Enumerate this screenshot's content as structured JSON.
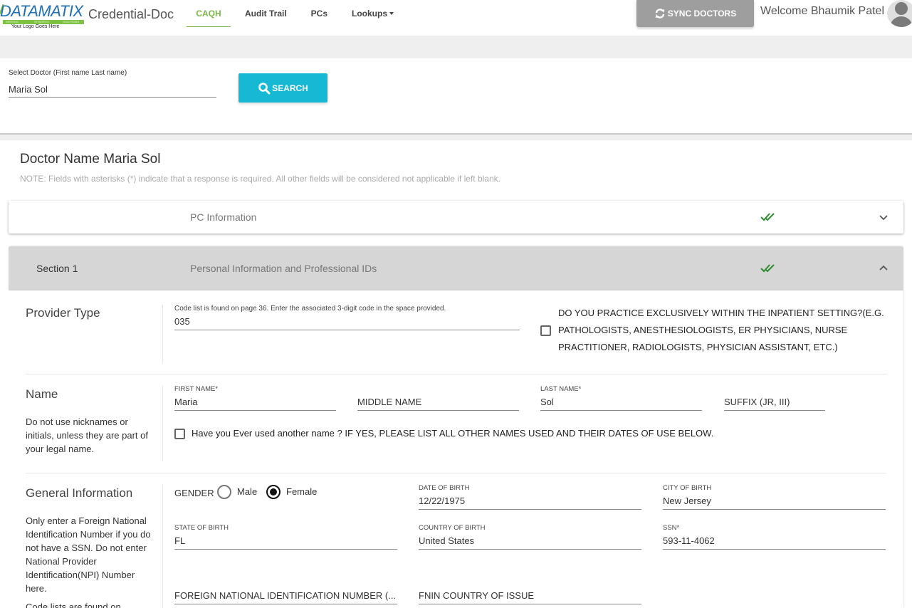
{
  "header": {
    "logo_word": "DATAMATIX",
    "logo_tags": [
      "SERVING",
      "STRATEGY",
      "SOLUTIONS"
    ],
    "logo_subtitle": "Your Logo Goes Here",
    "app_name": "Credential-Doc",
    "nav": [
      {
        "label": "CAQH",
        "active": true
      },
      {
        "label": "Audit Trail",
        "active": false
      },
      {
        "label": "PCs",
        "active": false
      },
      {
        "label": "Lookups",
        "active": false,
        "dropdown": true
      }
    ],
    "sync_label": "SYNC DOCTORS",
    "welcome": "Welcome Bhaumik Patel"
  },
  "search": {
    "label": "Select Doctor (First name Last name)",
    "value": "Maria Sol",
    "button_label": "SEARCH"
  },
  "main": {
    "title": "Doctor Name Maria Sol",
    "note": "NOTE: Fields with asterisks (*) indicate that a response is required. All other fields will be considered not applicable if left blank.",
    "accordions": [
      {
        "section": "",
        "title": "PC Information",
        "complete": true,
        "expanded": false
      },
      {
        "section": "Section 1",
        "title": "Personal Information and Professional IDs",
        "complete": true,
        "expanded": true
      }
    ]
  },
  "section1": {
    "provider_type": {
      "heading": "Provider Type",
      "code_label": "Code list is found on page 36. Enter the associated 3-digit code in the space provided.",
      "code_value": "035",
      "inpatient_question": "DO YOU PRACTICE EXCLUSIVELY WITHIN THE INPATIENT SETTING?(E.G. PATHOLOGISTS, ANESTHESIOLOGISTS, ER PHYSICIANS, NURSE PRACTITIONER, RADIOLOGISTS, PHYSICIAN ASSISTANT, ETC.)",
      "inpatient_checked": false
    },
    "name": {
      "heading": "Name",
      "description": "Do not use nicknames or initials, unless they are part of your legal name.",
      "first_name_label": "FIRST NAME*",
      "first_name": "Maria",
      "middle_name_placeholder": "MIDDLE NAME",
      "middle_name": "",
      "last_name_label": "LAST NAME*",
      "last_name": "Sol",
      "suffix_placeholder": "SUFFIX (JR, III)",
      "suffix": "",
      "other_name_question": "Have you Ever used another name ? IF YES, PLEASE LIST ALL OTHER NAMES USED AND THEIR DATES OF USE BELOW.",
      "other_name_checked": false
    },
    "general": {
      "heading": "General Information",
      "description": "Only enter a Foreign National Identification Number if you do not have a SSN. Do not enter National Provider Identification(NPI) Number here.",
      "description2": "Code lists are found on",
      "gender_label": "GENDER",
      "gender_options": [
        "Male",
        "Female"
      ],
      "gender_selected": "Female",
      "dob_label": "DATE OF BIRTH",
      "dob": "12/22/1975",
      "city_label": "CITY OF BIRTH",
      "city": "New Jersey",
      "state_label": "STATE OF BIRTH",
      "state": "FL",
      "country_label": "COUNTRY OF BIRTH",
      "country": "United States",
      "ssn_label": "SSN*",
      "ssn": "593-11-4062",
      "fnin_placeholder": "FOREIGN NATIONAL IDENTIFICATION NUMBER (...",
      "fnin_country_placeholder": "FNIN COUNTRY OF ISSUE"
    }
  },
  "colors": {
    "accent_green": "#7ab648",
    "search_button": "#17b8d3",
    "sync_button": "#9e9e9e",
    "check_green": "#2e8b2e"
  }
}
